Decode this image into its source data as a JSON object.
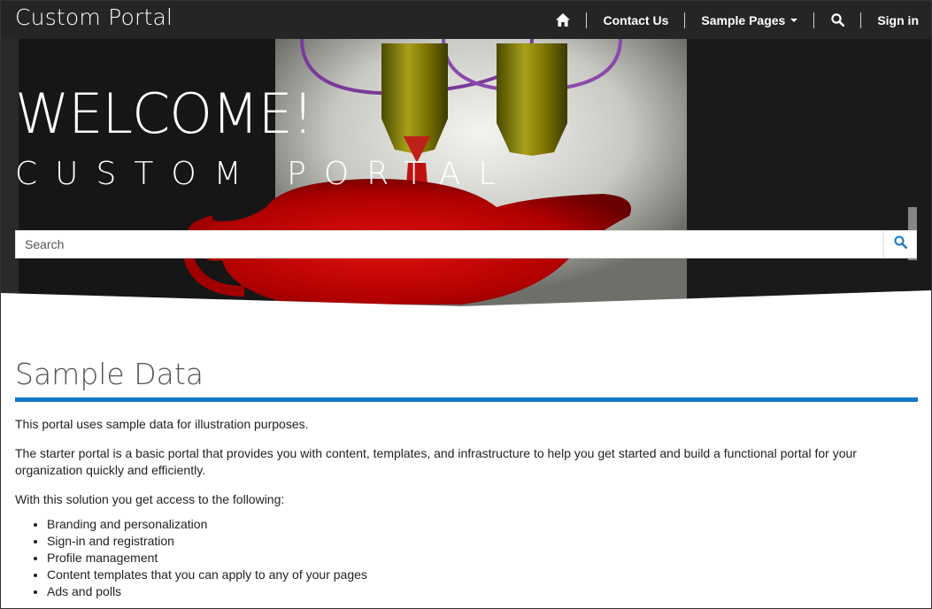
{
  "navbar": {
    "brand": "Custom Portal",
    "items": {
      "home_icon": "home-icon",
      "contact": "Contact Us",
      "sample_pages": "Sample Pages",
      "search_icon": "search-icon",
      "sign_in": "Sign in"
    },
    "background_color": "#252525"
  },
  "hero": {
    "title": "WELCOME!",
    "subtitle": "CUSTOM PORTAL",
    "search": {
      "placeholder": "Search",
      "button_icon": "search-icon"
    }
  },
  "main": {
    "title": "Sample Data",
    "accent_color": "#1577c8",
    "paragraphs": [
      "This portal uses sample data for illustration purposes.",
      "The starter portal is a basic portal that provides you with content, templates, and infrastructure to help you get started and build a functional portal for your organization quickly and efficiently.",
      "With this solution you get access to the following:"
    ],
    "features": [
      "Branding and personalization",
      "Sign-in and registration",
      "Profile management",
      "Content templates that you can apply to any of your pages",
      "Ads and polls"
    ]
  }
}
